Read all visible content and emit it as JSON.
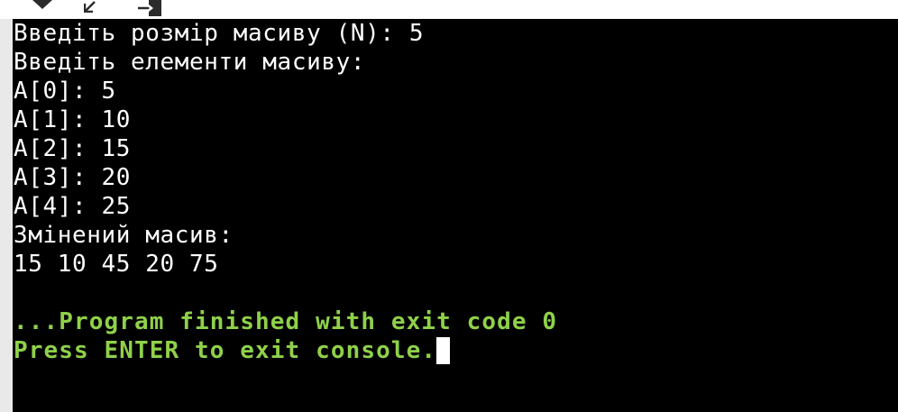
{
  "toolbar": {
    "icons": [
      "debug-icon",
      "restore-icon",
      "exit-icon"
    ]
  },
  "console": {
    "lines": [
      "Введіть розмір масиву (N): 5",
      "Введіть елементи масиву:",
      "A[0]: 5",
      "A[1]: 10",
      "A[2]: 15",
      "A[3]: 20",
      "A[4]: 25",
      "Змінений масив:",
      "15 10 45 20 75",
      ""
    ],
    "status_finished": "...Program finished with exit code 0",
    "status_prompt": "Press ENTER to exit console.",
    "colors": {
      "background": "#000000",
      "text": "#ffffff",
      "status": "#8fd14a"
    }
  }
}
